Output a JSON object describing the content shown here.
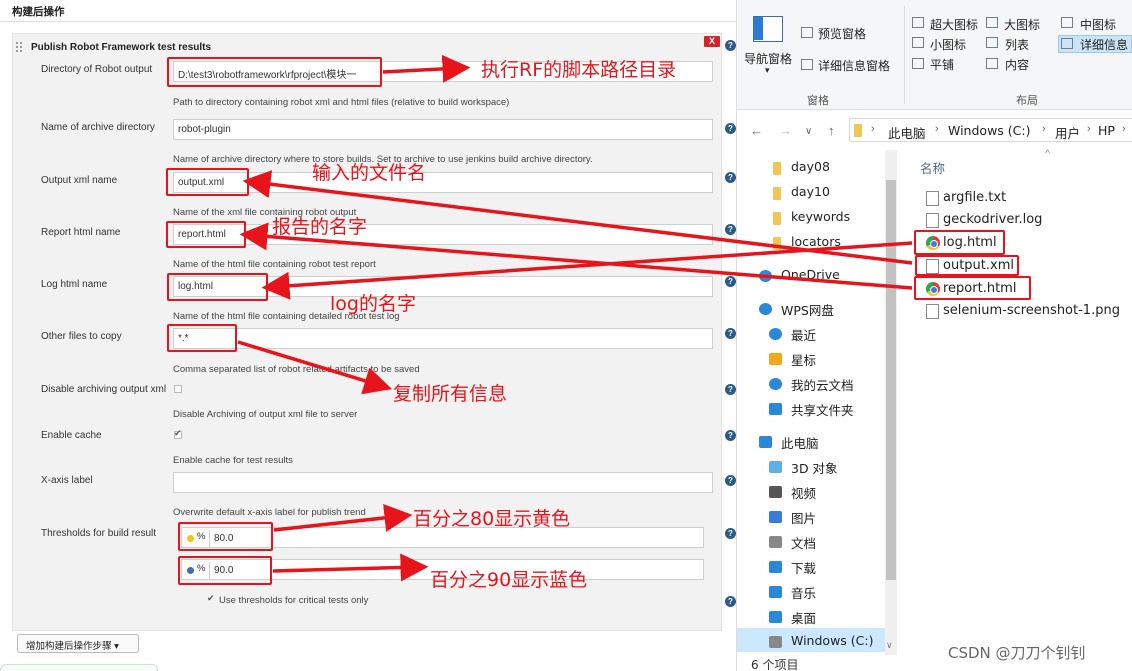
{
  "jenkins": {
    "section_header": "构建后操作",
    "panel_title": "Publish Robot Framework test results",
    "delete_label": "X",
    "help_label": "?",
    "fields": [
      {
        "label": "Directory of Robot output",
        "value": "D:\\test3\\robotframework\\rfproject\\模块一",
        "desc": "Path to directory containing robot xml and html files (relative to build workspace)"
      },
      {
        "label": "Name of archive directory",
        "value": "robot-plugin",
        "desc": "Name of archive directory where to store builds. Set to archive to use jenkins build archive directory."
      },
      {
        "label": "Output xml name",
        "value": "output.xml",
        "desc": "Name of the xml file containing robot output"
      },
      {
        "label": "Report html name",
        "value": "report.html",
        "desc": "Name of the html file containing robot test report"
      },
      {
        "label": "Log html name",
        "value": "log.html",
        "desc": "Name of the html file containing detailed robot test log"
      },
      {
        "label": "Other files to copy",
        "value": "*.*",
        "desc": "Comma separated list of robot related artifacts to be saved"
      }
    ],
    "disable_archiving": {
      "label": "Disable archiving output xml",
      "checked": false,
      "desc": "Disable Archiving of output xml file to server"
    },
    "enable_cache": {
      "label": "Enable cache",
      "checked": true,
      "desc": "Enable cache for test results"
    },
    "x_axis": {
      "label": "X-axis label",
      "value": "",
      "desc": "Overwrite default x-axis label for publish trend"
    },
    "thresholds": {
      "label": "Thresholds for build result",
      "percent_symbol": "%",
      "unstable_value": "80.0",
      "pass_value": "90.0",
      "unstable_color": "#f0c419",
      "pass_color": "#3a6fb0",
      "critical_label": "Use thresholds for critical tests only",
      "critical_checked": true
    },
    "add_step_button": "增加构建后操作步骤 ▾"
  },
  "annotations": {
    "script_path": "执行RF的脚本路径目录",
    "input_file": "输入的文件名",
    "report_name": "报告的名字",
    "log_name": "log的名字",
    "copy_all": "复制所有信息",
    "pct80": "百分之80显示黄色",
    "pct90": "百分之90显示蓝色",
    "annotation_color": "#e8141b"
  },
  "explorer": {
    "ribbon": {
      "nav_pane": "导航窗格",
      "preview_pane": "预览窗格",
      "details_pane": "详细信息窗格",
      "group_panes": "窗格",
      "views": [
        "超大图标",
        "大图标",
        "中图标",
        "小图标",
        "列表",
        "详细信息",
        "平铺",
        "内容"
      ],
      "group_layout": "布局"
    },
    "breadcrumb": [
      "此电脑",
      "Windows (C:)",
      "用户",
      "HP"
    ],
    "tree": [
      {
        "label": "day08",
        "icon": "folder-icon"
      },
      {
        "label": "day10",
        "icon": "folder-icon"
      },
      {
        "label": "keywords",
        "icon": "folder-icon"
      },
      {
        "label": "locators",
        "icon": "folder-icon"
      },
      {
        "label": "OneDrive",
        "icon": "cloud-icon"
      },
      {
        "label": "WPS网盘",
        "icon": "cloud-icon"
      },
      {
        "label": "最近",
        "icon": "clock-icon"
      },
      {
        "label": "星标",
        "icon": "star-icon"
      },
      {
        "label": "我的云文档",
        "icon": "cloud-icon"
      },
      {
        "label": "共享文件夹",
        "icon": "share-icon"
      },
      {
        "label": "此电脑",
        "icon": "computer-icon"
      },
      {
        "label": "3D 对象",
        "icon": "cube-icon"
      },
      {
        "label": "视频",
        "icon": "video-icon"
      },
      {
        "label": "图片",
        "icon": "image-icon"
      },
      {
        "label": "文档",
        "icon": "document-icon"
      },
      {
        "label": "下载",
        "icon": "download-icon"
      },
      {
        "label": "音乐",
        "icon": "music-icon"
      },
      {
        "label": "桌面",
        "icon": "desktop-icon"
      },
      {
        "label": "Windows (C:)",
        "icon": "drive-icon"
      }
    ],
    "column_name": "名称",
    "files": [
      {
        "name": "argfile.txt",
        "icon": "text-file-icon"
      },
      {
        "name": "geckodriver.log",
        "icon": "text-file-icon"
      },
      {
        "name": "log.html",
        "icon": "chrome-icon"
      },
      {
        "name": "output.xml",
        "icon": "xml-file-icon"
      },
      {
        "name": "report.html",
        "icon": "chrome-icon"
      },
      {
        "name": "selenium-screenshot-1.png",
        "icon": "image-file-icon"
      }
    ],
    "status": "6 个项目"
  },
  "watermark": "CSDN @刀刀个钊钊"
}
